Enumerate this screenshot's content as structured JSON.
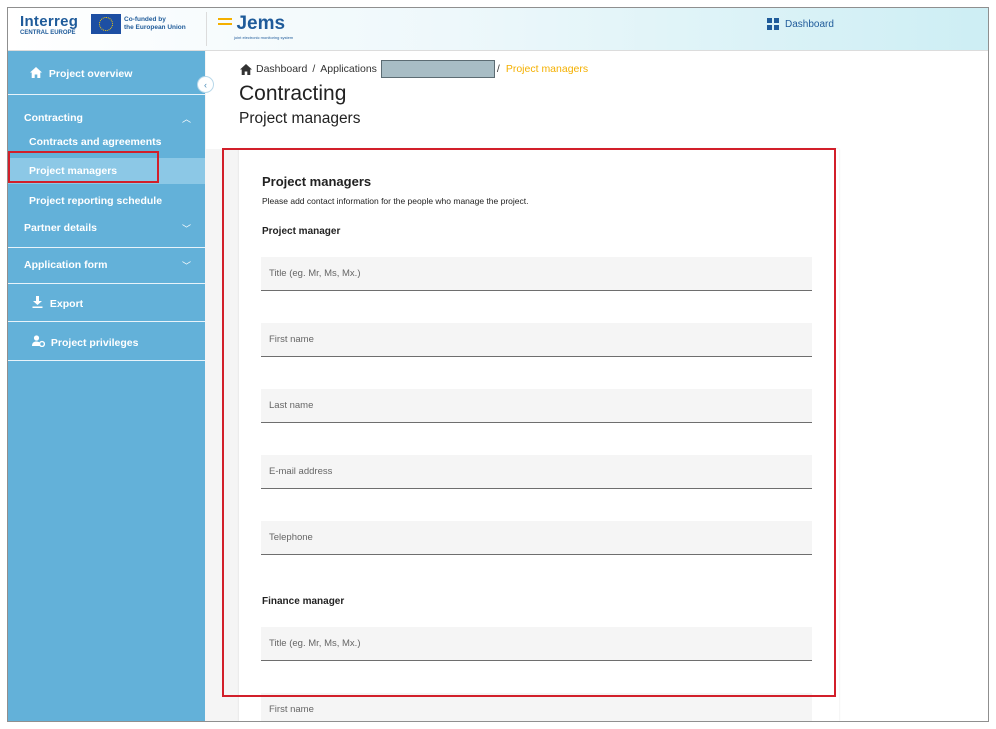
{
  "header": {
    "interreg_title": "Interreg",
    "interreg_subtitle": "CENTRAL EUROPE",
    "eu_text_line1": "Co-funded by",
    "eu_text_line2": "the European Union",
    "app_name": "Jems",
    "app_tagline": "joint electronic monitoring system",
    "dashboard_link": "Dashboard"
  },
  "sidebar": {
    "project_overview": "Project overview",
    "contracting": "Contracting",
    "contracts_agreements": "Contracts and agreements",
    "project_managers": "Project managers",
    "reporting_schedule": "Project reporting schedule",
    "partner_details": "Partner details",
    "application_form": "Application form",
    "export": "Export",
    "privileges": "Project privileges"
  },
  "breadcrumb": {
    "home": "Dashboard",
    "sep1": "/",
    "applications": "Applications",
    "sep2": "/",
    "current": "Project managers"
  },
  "page": {
    "title": "Contracting",
    "subtitle": "Project managers"
  },
  "form": {
    "section_title": "Project managers",
    "description": "Please add contact information for the people who manage the project.",
    "project_manager_heading": "Project manager",
    "finance_manager_heading": "Finance manager",
    "pm_title_placeholder": "Title (eg. Mr, Ms, Mx.)",
    "pm_first_name_placeholder": "First name",
    "pm_last_name_placeholder": "Last name",
    "pm_email_placeholder": "E-mail address",
    "pm_phone_placeholder": "Telephone",
    "fm_title_placeholder": "Title (eg. Mr, Ms, Mx.)",
    "fm_first_name_placeholder": "First name"
  }
}
